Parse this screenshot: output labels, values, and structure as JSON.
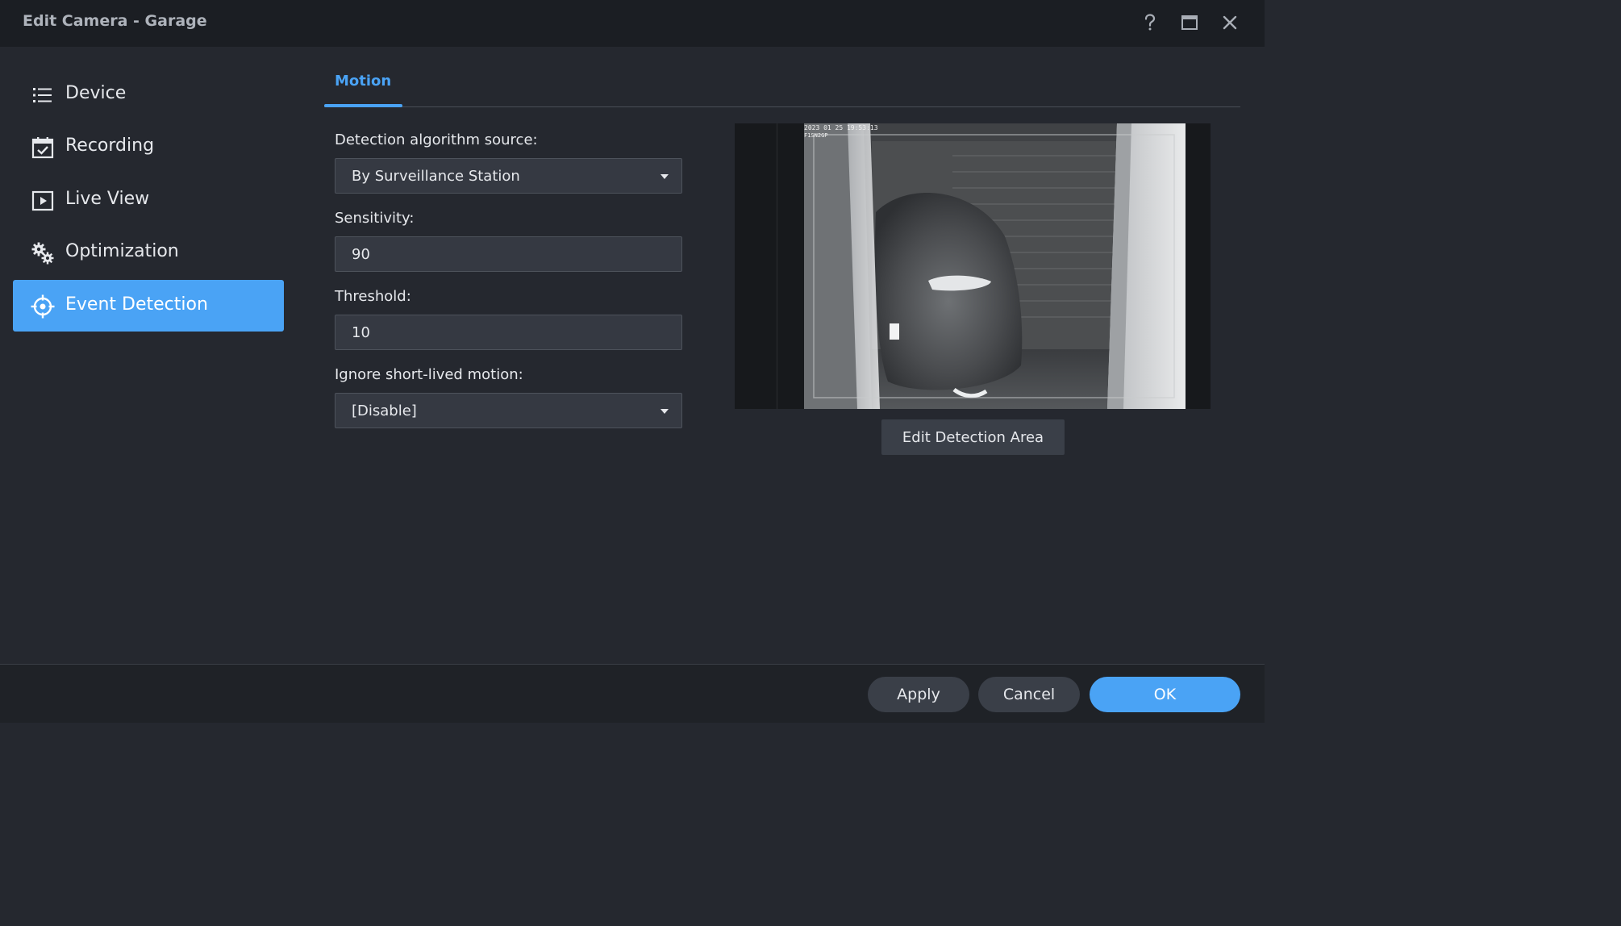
{
  "window": {
    "title": "Edit Camera - Garage",
    "controls": [
      "help-icon",
      "maximize-icon",
      "close-icon"
    ]
  },
  "sidebar": {
    "items": [
      {
        "label": "Device",
        "icon": "list-icon",
        "active": false
      },
      {
        "label": "Recording",
        "icon": "calendar-check-icon",
        "active": false
      },
      {
        "label": "Live View",
        "icon": "play-square-icon",
        "active": false
      },
      {
        "label": "Optimization",
        "icon": "gears-icon",
        "active": false
      },
      {
        "label": "Event Detection",
        "icon": "crosshair-icon",
        "active": true
      }
    ]
  },
  "main": {
    "tabs": [
      {
        "label": "Motion",
        "active": true
      }
    ],
    "form": {
      "detection_source_label": "Detection algorithm source:",
      "detection_source_value": "By Surveillance Station",
      "sensitivity_label": "Sensitivity:",
      "sensitivity_value": "90",
      "threshold_label": "Threshold:",
      "threshold_value": "10",
      "ignore_motion_label": "Ignore short-lived motion:",
      "ignore_motion_value": "[Disable]"
    },
    "preview": {
      "overlay_timestamp": "2023 01 25 19:53:13",
      "overlay_line2": "F1SN2GP",
      "edit_area_label": "Edit Detection Area"
    }
  },
  "footer": {
    "apply_label": "Apply",
    "cancel_label": "Cancel",
    "ok_label": "OK"
  },
  "colors": {
    "accent": "#4aa3f5",
    "background": "#25282f",
    "titlebar": "#1b1e23",
    "field": "#353942"
  }
}
